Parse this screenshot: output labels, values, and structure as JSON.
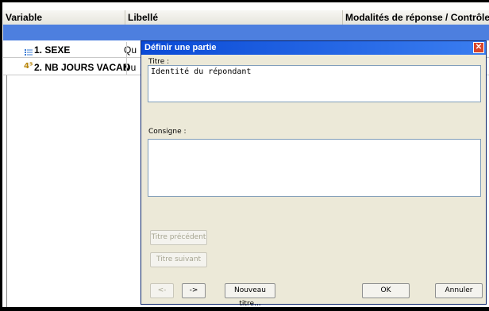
{
  "table": {
    "headers": {
      "variable": "Variable",
      "libelle": "Libellé",
      "modalites": "Modalités de réponse / Contrôles"
    },
    "rows": [
      {
        "variable": "1. SEXE",
        "libelle": "Qu",
        "icon": "list-icon"
      },
      {
        "variable": "2. NB JOURS VACAN",
        "libelle": "Du",
        "icon": "numeric-icon",
        "icon_glyph": "4⁵"
      }
    ]
  },
  "dialog": {
    "title": "Définir une partie",
    "close_glyph": "✕",
    "titre_label": "Titre :",
    "titre_value": "Identité du répondant",
    "consigne_label": "Consigne :",
    "consigne_value": "",
    "buttons": {
      "prev_title": "Titre précédent",
      "next_title": "Titre suivant",
      "back": "<-",
      "forward": "->",
      "new_title": "Nouveau titre...",
      "ok": "OK",
      "cancel": "Annuler"
    }
  }
}
